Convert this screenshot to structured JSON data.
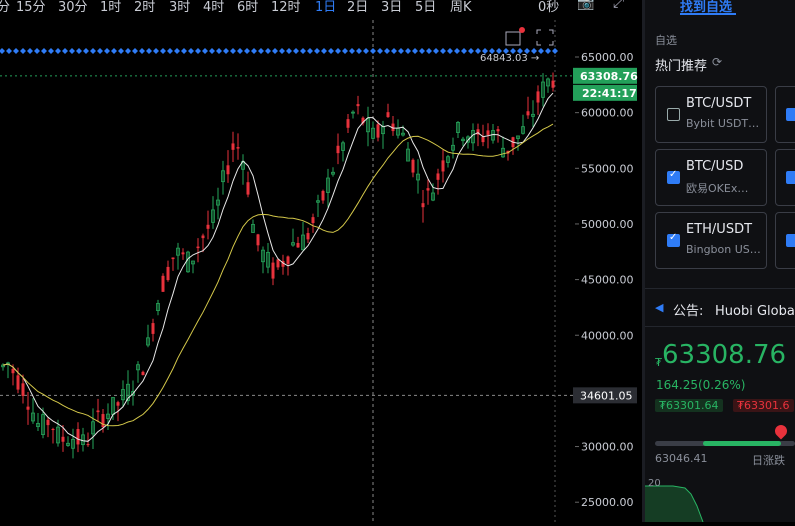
{
  "toolbar": {
    "timeframes": [
      "分",
      "15分",
      "30分",
      "1时",
      "2时",
      "3时",
      "4时",
      "6时",
      "12时",
      "1日",
      "2日",
      "3日",
      "5日",
      "周K"
    ],
    "active": "1日",
    "countdown": "0秒",
    "icons": [
      "camera-icon",
      "fullscreen-icon"
    ]
  },
  "chart": {
    "current_price": "63308.76",
    "countdown": "22:41:17",
    "cursor_price": "34601.05",
    "high_marker": "64843.03 →",
    "axis_ticks": [
      "65000.00",
      "60000.00",
      "55000.00",
      "50000.00",
      "45000.00",
      "40000.00",
      "30000.00",
      "25000.00"
    ],
    "colors": {
      "up": "#26a65b",
      "down": "#e8323c",
      "ma_fast": "#e8e8e8",
      "ma_slow": "#d4c84a",
      "accent": "#2f7cf6",
      "price_tag": "#23a05a"
    },
    "icons": [
      "calendar-icon",
      "expand-icon"
    ]
  },
  "sidebar": {
    "title": "找到自选",
    "section_label": "自选",
    "hot_label": "热门推荐",
    "refresh_icon": "refresh-icon",
    "cards": [
      {
        "name": "BTC/USDT",
        "exchange": "Bybit USDT…",
        "checked": false
      },
      {
        "name": "BTC/USD",
        "exchange": "欧易OKEx…",
        "checked": true
      },
      {
        "name": "ETH/USDT",
        "exchange": "Bingbon US…",
        "checked": true
      }
    ],
    "notice_prefix": "公告:",
    "notice_text": "Huobi Global将",
    "price": "63308.76",
    "price_prefix": "₮",
    "change": "164.25(0.26%)",
    "bid": "₮63301.64",
    "ask": "₮63301.6",
    "low": "63046.41",
    "range_label": "日涨跌",
    "depth_label": "20"
  }
}
